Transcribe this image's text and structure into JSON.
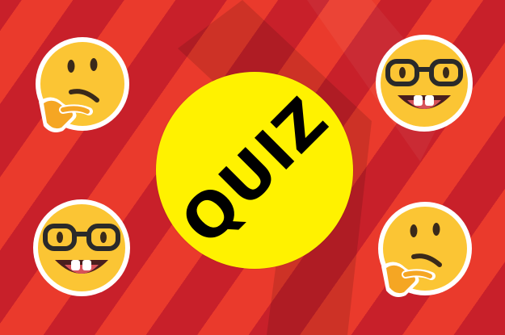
{
  "badge": {
    "label": "QUIZ"
  },
  "emojis": [
    {
      "name": "thinking-face-icon"
    },
    {
      "name": "nerd-face-icon"
    },
    {
      "name": "nerd-face-icon"
    },
    {
      "name": "thinking-face-icon"
    }
  ],
  "colors": {
    "stripe_a": "#c8202a",
    "stripe_b": "#ea3a2c",
    "yellow": "#fff200",
    "emoji_yellow": "#fbc534",
    "outline": "#ffffff"
  }
}
